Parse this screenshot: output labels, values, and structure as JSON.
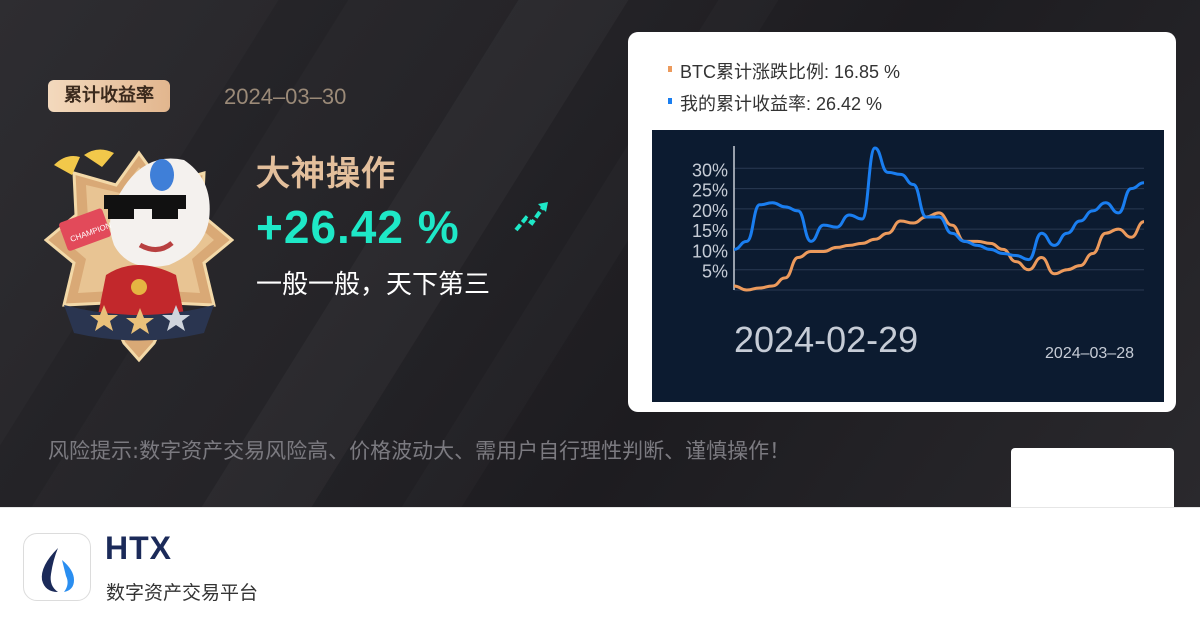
{
  "badge_label": "累计收益率",
  "report_date": "2024–03–30",
  "rank_title": "大神操作",
  "return_value": "+26.42 %",
  "remark": "一般一般，天下第三",
  "disclaimer": "风险提示:数字资产交易风险高、价格波动大、需用户自行理性判断、谨慎操作！",
  "mascot": {
    "card_text": "CHAMPION",
    "stars_filled": 2,
    "stars_total": 3
  },
  "legend": {
    "btc_label": "BTC累计涨跌比例: 16.85 %",
    "mine_label": "我的累计收益率: 26.42 %"
  },
  "colors": {
    "btc": "#ec9a5c",
    "mine": "#1a7ef0",
    "return": "#1ee8c7",
    "title": "#e3bf9c",
    "plot_bg": "#0c1b30"
  },
  "chart_data": {
    "type": "line",
    "x_start_label": "2024-02-29",
    "x_end_label": "2024–03–28",
    "yticks": [
      "30%",
      "25%",
      "20%",
      "15%",
      "10%",
      "5%"
    ],
    "ylim": [
      0,
      35
    ],
    "series": [
      {
        "name": "BTC累计涨跌比例",
        "values": [
          1,
          0,
          0.5,
          1,
          3,
          8,
          9.5,
          9.5,
          10.5,
          11,
          11.5,
          12.5,
          14,
          17,
          16.5,
          18,
          19,
          16,
          12,
          12,
          11.5,
          10,
          7,
          5,
          8,
          4,
          5,
          6,
          9,
          14,
          15,
          13,
          16.85
        ]
      },
      {
        "name": "我的累计收益率",
        "values": [
          10,
          12,
          21,
          21.5,
          20.5,
          19.5,
          12,
          16,
          15.5,
          18.5,
          17.5,
          35,
          29,
          28.5,
          26,
          18,
          18,
          14,
          12,
          11,
          10,
          9,
          8.5,
          7.5,
          14,
          11,
          14,
          17,
          19.5,
          21.5,
          19,
          25,
          26.42
        ]
      }
    ]
  },
  "app": {
    "name": "HTX",
    "tagline": "数字资产交易平台"
  }
}
